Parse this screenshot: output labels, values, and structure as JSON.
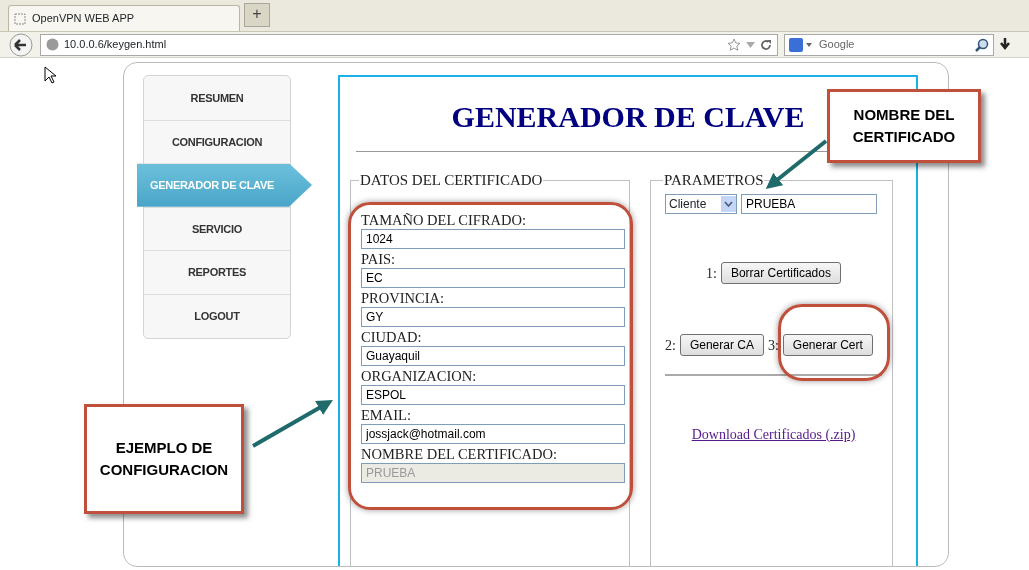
{
  "browser": {
    "tab_title": "OpenVPN WEB APP",
    "new_tab": "+",
    "url": "10.0.0.6/keygen.html",
    "search_placeholder": "Google"
  },
  "sidebar": {
    "items": [
      {
        "label": "RESUMEN",
        "selected": false
      },
      {
        "label": "CONFIGURACION",
        "selected": false
      },
      {
        "label": "GENERADOR DE CLAVE",
        "selected": true
      },
      {
        "label": "SERVICIO",
        "selected": false
      },
      {
        "label": "REPORTES",
        "selected": false
      },
      {
        "label": "LOGOUT",
        "selected": false
      }
    ]
  },
  "page": {
    "title": "GENERADOR DE CLAVE"
  },
  "datos": {
    "legend": "DATOS DEL CERTIFICADO",
    "fields": [
      {
        "label": "TAMAÑO DEL CIFRADO:",
        "value": "1024",
        "disabled": false
      },
      {
        "label": "PAIS:",
        "value": "EC",
        "disabled": false
      },
      {
        "label": "PROVINCIA:",
        "value": "GY",
        "disabled": false
      },
      {
        "label": "CIUDAD:",
        "value": "Guayaquil",
        "disabled": false
      },
      {
        "label": "ORGANIZACION:",
        "value": "ESPOL",
        "disabled": false
      },
      {
        "label": "EMAIL:",
        "value": "jossjack@hotmail.com",
        "disabled": false
      },
      {
        "label": "NOMBRE DEL CERTIFICADO:",
        "value": "PRUEBA",
        "disabled": true
      }
    ]
  },
  "parametros": {
    "legend": "PARAMETROS",
    "type_select": "Cliente",
    "name_value": "PRUEBA",
    "step_rows": [
      [
        {
          "number": "1:",
          "button": "Borrar Certificados"
        }
      ],
      [
        {
          "number": "2:",
          "button": "Generar CA"
        },
        {
          "number": "3:",
          "button": "Generar Cert"
        }
      ]
    ],
    "download_link": "Download Certificados (.zip)"
  },
  "annotations": [
    {
      "text": "NOMBRE DEL CERTIFICADO"
    },
    {
      "text": "EJEMPLO DE CONFIGURACION"
    }
  ]
}
